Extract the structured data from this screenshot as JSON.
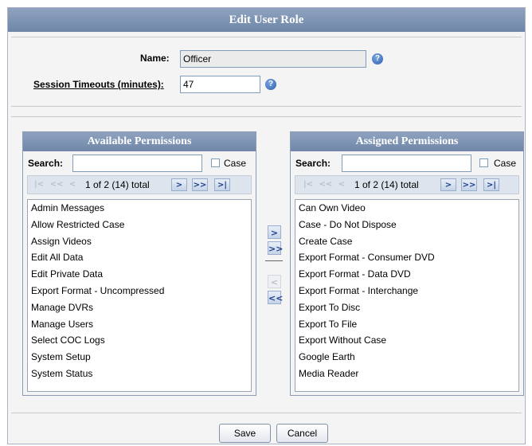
{
  "dialog": {
    "title": "Edit User Role"
  },
  "form": {
    "name_label": "Name:",
    "name_value": "Officer",
    "timeout_label": "Session Timeouts (minutes):",
    "timeout_value": "47",
    "help_glyph": "?"
  },
  "available": {
    "title": "Available Permissions",
    "search_label": "Search:",
    "search_value": "",
    "case_label": "Case",
    "pager_text": "1 of 2 (14) total",
    "items": [
      "Admin Messages",
      "Allow Restricted Case",
      "Assign Videos",
      "Edit All Data",
      "Edit Private Data",
      "Export Format - Uncompressed",
      "Manage DVRs",
      "Manage Users",
      "Select COC Logs",
      "System Setup",
      "System Status"
    ]
  },
  "assigned": {
    "title": "Assigned Permissions",
    "search_label": "Search:",
    "search_value": "",
    "case_label": "Case",
    "pager_text": "1 of 2 (14) total",
    "items": [
      "Can Own Video",
      "Case - Do Not Dispose",
      "Create Case",
      "Export Format - Consumer DVD",
      "Export Format - Data DVD",
      "Export Format - Interchange",
      "Export To Disc",
      "Export To File",
      "Export Without Case",
      "Google Earth",
      "Media Reader"
    ]
  },
  "pager_icons": {
    "first": "|<",
    "prev_page": "<<",
    "prev": "<",
    "next": ">",
    "next_page": ">>",
    "last": ">|"
  },
  "transfer_icons": {
    "add": ">",
    "add_all": ">>",
    "remove": "<",
    "remove_all": "<<"
  },
  "buttons": {
    "save": "Save",
    "cancel": "Cancel"
  },
  "colors": {
    "header": "#7a8fb0",
    "accent": "#2e5fb0"
  }
}
